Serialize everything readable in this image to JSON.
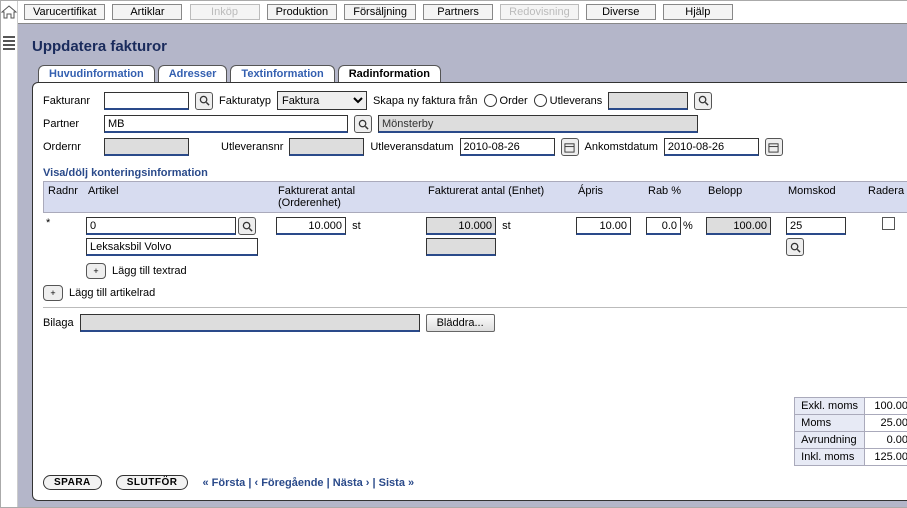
{
  "menu": {
    "items": [
      "Varucertifikat",
      "Artiklar",
      "Inköp",
      "Produktion",
      "Försäljning",
      "Partners",
      "Redovisning",
      "Diverse",
      "Hjälp"
    ],
    "disabled": [
      2,
      6
    ]
  },
  "page": {
    "title": "Uppdatera fakturor"
  },
  "tabs": [
    "Huvudinformation",
    "Adresser",
    "Textinformation",
    "Radinformation"
  ],
  "active_tab": 3,
  "form": {
    "fakturanr_label": "Fakturanr",
    "fakturanr": "",
    "fakturatyp_label": "Fakturatyp",
    "fakturatyp": "Faktura",
    "skapa_label": "Skapa ny faktura från",
    "radio_order": "Order",
    "radio_utlev": "Utleverans",
    "utlev_lookup": "",
    "partner_label": "Partner",
    "partner": "MB",
    "partner_name": "Mönsterby",
    "ordernr_label": "Ordernr",
    "ordernr": "",
    "utleveransnr_label": "Utleveransnr",
    "utleveransnr": "",
    "utleveransdatum_label": "Utleveransdatum",
    "utleveransdatum": "2010-08-26",
    "ankomstdatum_label": "Ankomstdatum",
    "ankomstdatum": "2010-08-26"
  },
  "subhead": "Visa/dölj konteringsinformation",
  "grid": {
    "headers": {
      "radnr": "Radnr",
      "artikel": "Artikel",
      "fakt_order": "Fakturerat antal (Orderenhet)",
      "fakt_enhet": "Fakturerat antal (Enhet)",
      "apris": "Ápris",
      "rab": "Rab %",
      "belopp": "Belopp",
      "momskod": "Momskod",
      "radera": "Radera"
    },
    "row": {
      "radnr": "*",
      "artikel_code": "0",
      "artikel_name": "Leksaksbil Volvo",
      "fakt_order": "10.000",
      "unit1": "st",
      "fakt_enhet": "10.000",
      "unit2": "st",
      "apris": "10.00",
      "rab": "0.0",
      "rab_unit": "%",
      "belopp": "100.00",
      "momskod": "25"
    },
    "add_textrad": "Lägg till textrad",
    "add_artikelrad": "Lägg till artikelrad"
  },
  "attach": {
    "bilaga_label": "Bilaga",
    "bilaga": "",
    "browse": "Bläddra..."
  },
  "buttons": {
    "spara": "SPARA",
    "slutfor": "SLUTFÖR"
  },
  "nav": {
    "first": "« Första",
    "prev": "‹ Föregående",
    "next": "Nästa ›",
    "last": "Sista »"
  },
  "totals": {
    "exkl_label": "Exkl. moms",
    "exkl": "100.00",
    "moms_label": "Moms",
    "moms": "25.00",
    "avr_label": "Avrundning",
    "avr": "0.00",
    "inkl_label": "Inkl. moms",
    "inkl": "125.00"
  }
}
